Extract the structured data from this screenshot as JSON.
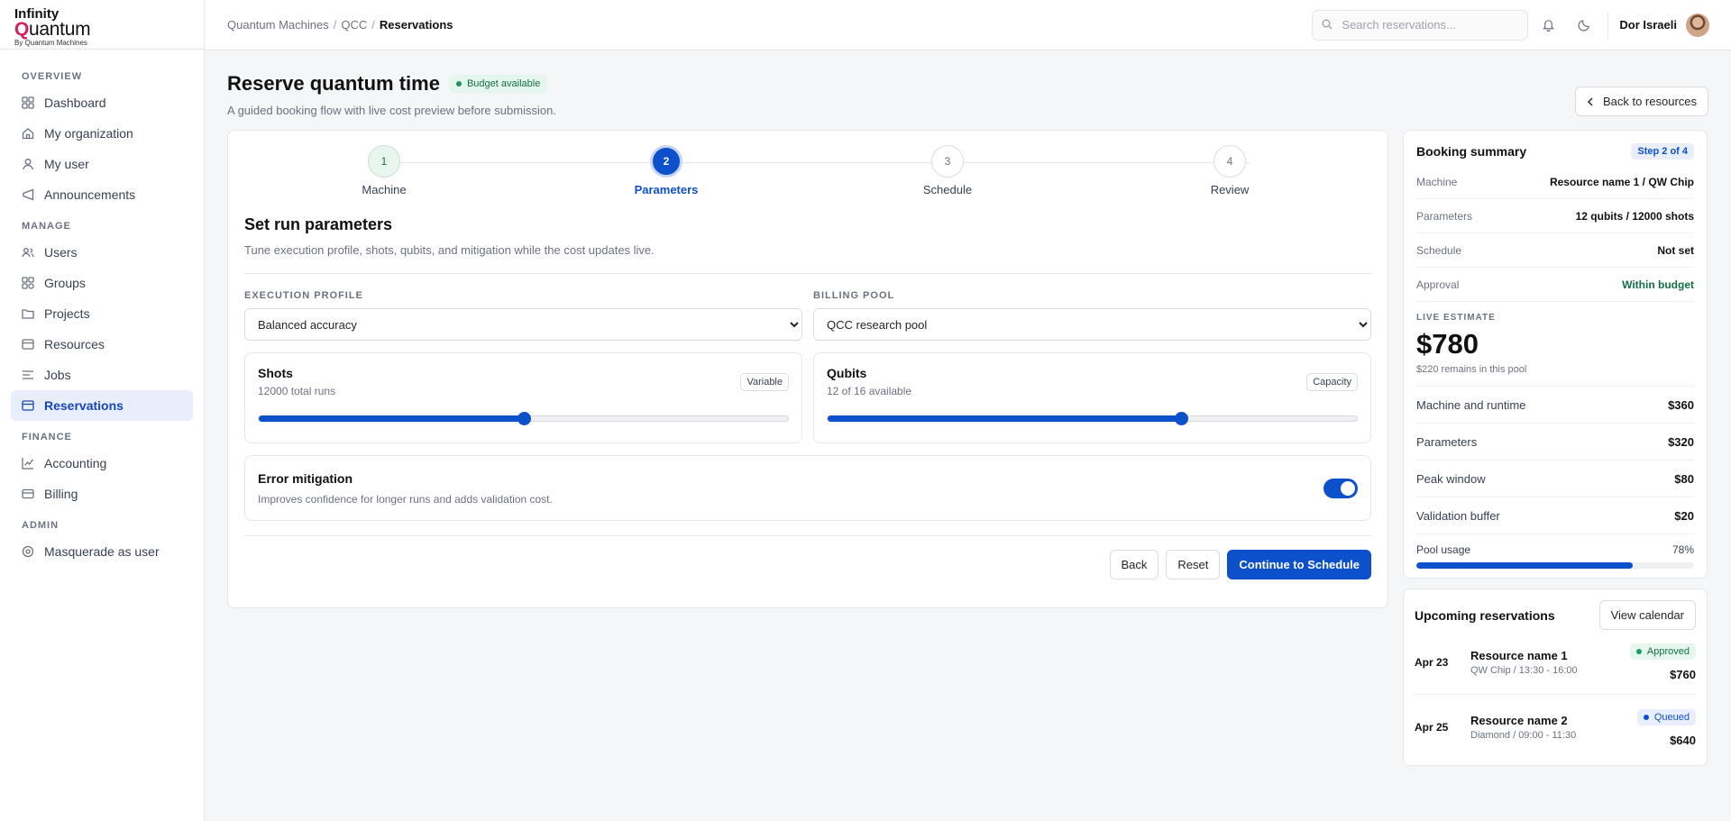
{
  "brand": {
    "line1": "Infinity",
    "line2_q": "Q",
    "line2_rest": "uantum",
    "line3": "By Quantum Machines"
  },
  "sidebar": {
    "sections": [
      {
        "title": "OVERVIEW",
        "items": [
          {
            "label": "Dashboard",
            "icon": "grid-icon"
          },
          {
            "label": "My organization",
            "icon": "home-icon"
          },
          {
            "label": "My user",
            "icon": "user-icon"
          },
          {
            "label": "Announcements",
            "icon": "megaphone-icon"
          }
        ]
      },
      {
        "title": "MANAGE",
        "items": [
          {
            "label": "Users",
            "icon": "users-icon"
          },
          {
            "label": "Groups",
            "icon": "groups-icon"
          },
          {
            "label": "Projects",
            "icon": "folder-icon"
          },
          {
            "label": "Resources",
            "icon": "server-icon"
          },
          {
            "label": "Jobs",
            "icon": "list-icon"
          },
          {
            "label": "Reservations",
            "icon": "calendar-icon"
          }
        ]
      },
      {
        "title": "FINANCE",
        "items": [
          {
            "label": "Accounting",
            "icon": "chart-icon"
          },
          {
            "label": "Billing",
            "icon": "card-icon"
          }
        ]
      },
      {
        "title": "ADMIN",
        "items": [
          {
            "label": "Masquerade as user",
            "icon": "eye-icon"
          }
        ]
      }
    ]
  },
  "topbar": {
    "crumbs": [
      "Quantum Machines",
      "QCC",
      "Reservations"
    ],
    "search_placeholder": "Search reservations...",
    "user_name": "Dor Israeli"
  },
  "page": {
    "title": "Reserve quantum time",
    "badge": "Budget available",
    "subtitle": "A guided booking flow with live cost preview before submission.",
    "back_button": "Back to resources"
  },
  "stepper": {
    "steps": [
      {
        "num": "1",
        "label": "Machine"
      },
      {
        "num": "2",
        "label": "Parameters"
      },
      {
        "num": "3",
        "label": "Schedule"
      },
      {
        "num": "4",
        "label": "Review"
      }
    ]
  },
  "form": {
    "title": "Set run parameters",
    "subtitle": "Tune execution profile, shots, qubits, and mitigation while the cost updates live.",
    "execution_profile_label": "EXECUTION PROFILE",
    "execution_profile_value": "Balanced accuracy",
    "billing_pool_label": "BILLING POOL",
    "billing_pool_value": "QCC research pool",
    "shots": {
      "title": "Shots",
      "sub": "12000 total runs",
      "tag": "Variable",
      "fraction": 0.5
    },
    "qubits": {
      "title": "Qubits",
      "sub": "12 of 16 available",
      "tag": "Capacity",
      "fraction": 0.667
    },
    "mitigation": {
      "title": "Error mitigation",
      "sub": "Improves confidence for longer runs and adds validation cost."
    },
    "buttons": {
      "back": "Back",
      "reset": "Reset",
      "continue": "Continue to Schedule"
    }
  },
  "summary": {
    "title": "Booking summary",
    "badge": "Step 2 of 4",
    "rows": [
      {
        "k": "Machine",
        "v": "Resource name 1 / QW Chip"
      },
      {
        "k": "Parameters",
        "v": "12 qubits / 12000 shots"
      },
      {
        "k": "Schedule",
        "v": "Not set"
      },
      {
        "k": "Approval",
        "v": "Within budget"
      }
    ],
    "estimate_label": "LIVE ESTIMATE",
    "estimate": "$780",
    "remaining": "$220 remains in this pool",
    "costs": [
      {
        "k": "Machine and runtime",
        "v": "$360"
      },
      {
        "k": "Parameters",
        "v": "$320"
      },
      {
        "k": "Peak window",
        "v": "$80"
      },
      {
        "k": "Validation buffer",
        "v": "$20"
      }
    ],
    "pool_label": "Pool usage",
    "pool_value": "78%",
    "pool_fraction": 0.78
  },
  "upcoming": {
    "title": "Upcoming reservations",
    "button": "View calendar",
    "items": [
      {
        "date": "Apr 23",
        "name": "Resource name 1",
        "meta": "QW Chip / 13:30 - 16:00",
        "status": "Approved",
        "cost": "$760"
      },
      {
        "date": "Apr 25",
        "name": "Resource name 2",
        "meta": "Diamond / 09:00 - 11:30",
        "status": "Queued",
        "cost": "$640"
      }
    ]
  },
  "colors": {
    "accent": "#0d50cc",
    "brand": "#d6215f",
    "success": "#127048"
  }
}
